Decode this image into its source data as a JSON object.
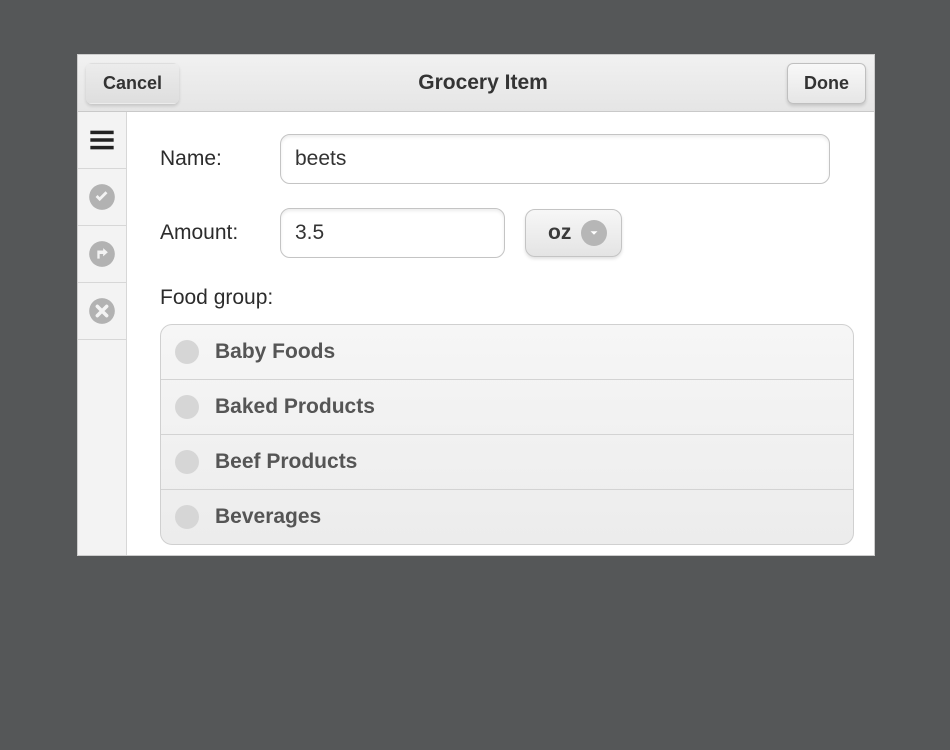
{
  "header": {
    "cancel_label": "Cancel",
    "title": "Grocery Item",
    "done_label": "Done"
  },
  "form": {
    "name_label": "Name:",
    "name_value": "beets",
    "amount_label": "Amount:",
    "amount_value": "3.5",
    "unit_label": "oz",
    "food_group_label": "Food group:"
  },
  "food_groups": [
    {
      "label": "Baby Foods"
    },
    {
      "label": "Baked Products"
    },
    {
      "label": "Beef Products"
    },
    {
      "label": "Beverages"
    }
  ],
  "sidebar_icons": [
    "hamburger-icon",
    "check-circle-icon",
    "share-icon",
    "close-circle-icon"
  ]
}
